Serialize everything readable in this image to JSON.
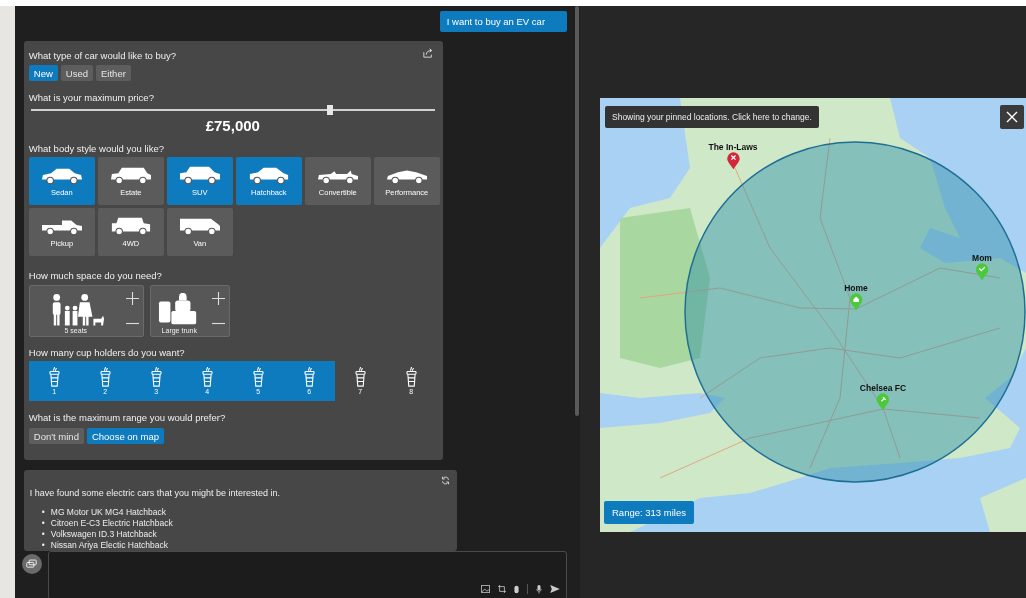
{
  "user_message": "I want to buy an EV car",
  "form": {
    "car_type": {
      "question": "What type of car would like to buy?",
      "options": [
        {
          "label": "New",
          "selected": true
        },
        {
          "label": "Used",
          "selected": false
        },
        {
          "label": "Either",
          "selected": false
        }
      ]
    },
    "price": {
      "question": "What is your maximum price?",
      "level": 0.74,
      "value": "£75,000"
    },
    "body_style": {
      "question": "What body style would you like?",
      "options": [
        {
          "label": "Sedan",
          "kind": "sedan",
          "selected": true
        },
        {
          "label": "Estate",
          "kind": "estate",
          "selected": false
        },
        {
          "label": "SUV",
          "kind": "suv",
          "selected": true
        },
        {
          "label": "Hatchback",
          "kind": "hatchback",
          "selected": true
        },
        {
          "label": "Convertible",
          "kind": "convertible",
          "selected": false
        },
        {
          "label": "Performance",
          "kind": "performance",
          "selected": false
        },
        {
          "label": "Pickup",
          "kind": "pickup",
          "selected": false
        },
        {
          "label": "4WD",
          "kind": "offroad",
          "selected": false
        },
        {
          "label": "Van",
          "kind": "van",
          "selected": false
        }
      ]
    },
    "space": {
      "question": "How much space do you need?",
      "options": [
        {
          "label": "5 seats",
          "kind": "seats"
        },
        {
          "label": "Large trunk",
          "kind": "trunk"
        }
      ]
    },
    "cup_holders": {
      "question": "How many cup holders do you want?",
      "options": [
        {
          "label": "1",
          "selected": true
        },
        {
          "label": "2",
          "selected": true
        },
        {
          "label": "3",
          "selected": true
        },
        {
          "label": "4",
          "selected": true
        },
        {
          "label": "5",
          "selected": true
        },
        {
          "label": "6",
          "selected": true
        },
        {
          "label": "7",
          "selected": false
        },
        {
          "label": "8",
          "selected": false
        }
      ]
    },
    "range": {
      "question": "What is the maximum range you would prefer?",
      "options": [
        {
          "label": "Don't mind",
          "selected": false
        },
        {
          "label": "Choose on map",
          "selected": true
        }
      ]
    }
  },
  "result": {
    "intro": "I have found some electric cars that you might be interested in.",
    "items": [
      {
        "bullet": "•",
        "text": "MG Motor UK MG4 Hatchback"
      },
      {
        "bullet": "•",
        "text": "Citroen E-C3 Electric Hatchback"
      },
      {
        "bullet": "•",
        "text": "Volkswagen ID.3 Hatchback"
      },
      {
        "bullet": "•",
        "text": "Nissan Ariya Electic Hatchback"
      }
    ]
  },
  "map": {
    "notice": "Showing your pinned locations. Click here to change.",
    "range_label": "Range: 313 miles",
    "pins": [
      {
        "label": "The In-Laws",
        "kind": "avoid",
        "color": "#d3283a"
      },
      {
        "label": "Home",
        "kind": "home",
        "color": "#4cc83c"
      },
      {
        "label": "Mom",
        "kind": "check",
        "color": "#4cc83c"
      },
      {
        "label": "Chelsea FC",
        "kind": "pin",
        "color": "#4cc83c"
      }
    ]
  }
}
